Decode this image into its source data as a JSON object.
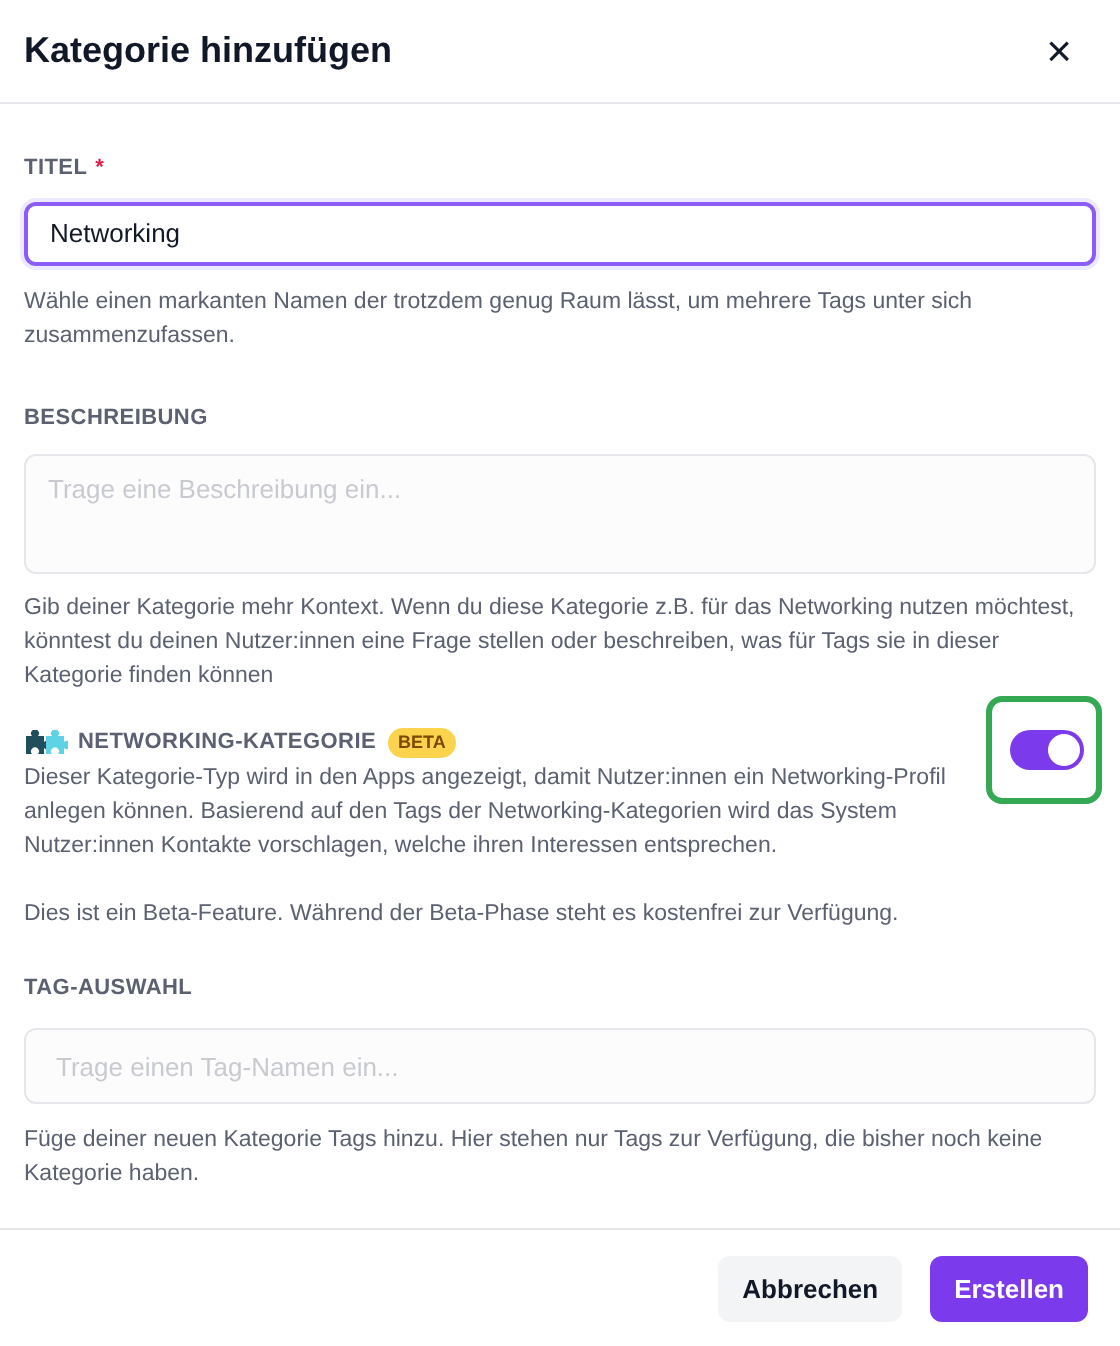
{
  "dialog": {
    "title": "Kategorie hinzufügen",
    "close": "×"
  },
  "title_field": {
    "label": "TITEL",
    "required": true,
    "required_mark": "*",
    "value": "Networking",
    "focused": true,
    "hint": "Wähle einen markanten Namen der trotzdem genug Raum lässt, um mehrere Tags unter sich zusammenzufassen."
  },
  "description_field": {
    "label": "BESCHREIBUNG",
    "placeholder": "Trage eine Beschreibung ein...",
    "hint": "Gib deiner Kategorie mehr Kontext. Wenn du diese Kategorie z.B. für das Networking nutzen möchtest, könntest du deinen Nutzer:innen eine Frage stellen oder beschreiben, was für Tags sie in dieser Kategorie finden können"
  },
  "networking": {
    "label": "NETWORKING-KATEGORIE",
    "badge": "BETA",
    "on": true,
    "highlighted": true,
    "description": "Dieser Kategorie-Typ wird in den Apps angezeigt, damit Nutzer:innen ein Networking-Profil anlegen können. Basierend auf den Tags der Networking-Kategorien wird das System Nutzer:innen Kontakte vorschlagen, welche ihren Interessen entsprechen.",
    "note": "Dies ist ein Beta-Feature. Während der Beta-Phase steht es kostenfrei zur Verfügung."
  },
  "tag_field": {
    "label": "TAG-AUSWAHL",
    "placeholder": "Trage einen Tag-Namen ein...",
    "hint": "Füge deiner neuen Kategorie Tags hinzu. Hier stehen nur Tags zur Verfügung, die bisher noch keine Kategorie haben."
  },
  "buttons": [
    {
      "label": "Abbrechen",
      "kind": "secondary"
    },
    {
      "label": "Erstellen",
      "kind": "primary"
    }
  ]
}
